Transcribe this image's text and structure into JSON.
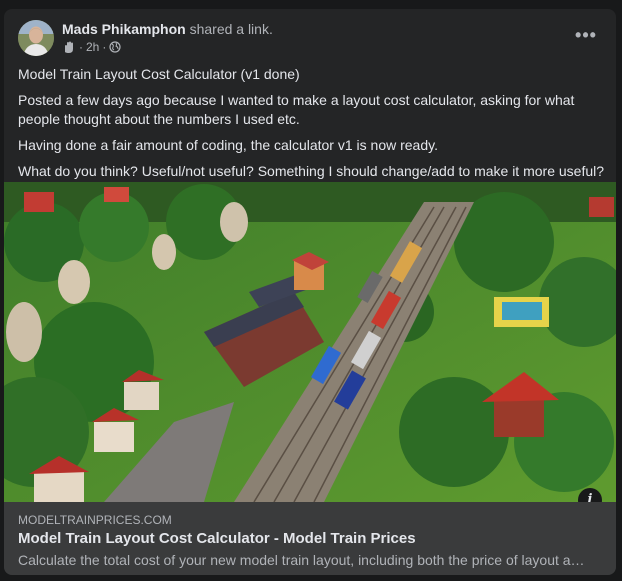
{
  "post": {
    "author": "Mads Phikamphon",
    "action": "shared a link.",
    "time": "2h",
    "more_label": "•••",
    "privacy_icon": "globe-icon",
    "group_icon": "waving-hand-icon",
    "avatar_icon": "avatar-photo"
  },
  "content": {
    "paragraphs": [
      "Model Train Layout Cost Calculator (v1 done)",
      "Posted a few days ago because I wanted to make a layout cost calculator, asking for what people thought about the numbers I used etc.",
      "Having done a fair amount of coding, the calculator v1 is now ready.",
      "What do you think? Useful/not useful? Something I should change/add to make it more useful?"
    ]
  },
  "link_preview": {
    "domain": "MODELTRAINPRICES.COM",
    "title": "Model Train Layout Cost Calculator - Model Train Prices",
    "description": "Calculate the total cost of your new model train layout, including both the price of layout and ...",
    "info_label": "i"
  },
  "colors": {
    "page_bg": "#18191a",
    "card_bg": "#242526",
    "link_bg": "#3a3b3c",
    "text_primary": "#e4e6eb",
    "text_secondary": "#b0b3b8"
  }
}
